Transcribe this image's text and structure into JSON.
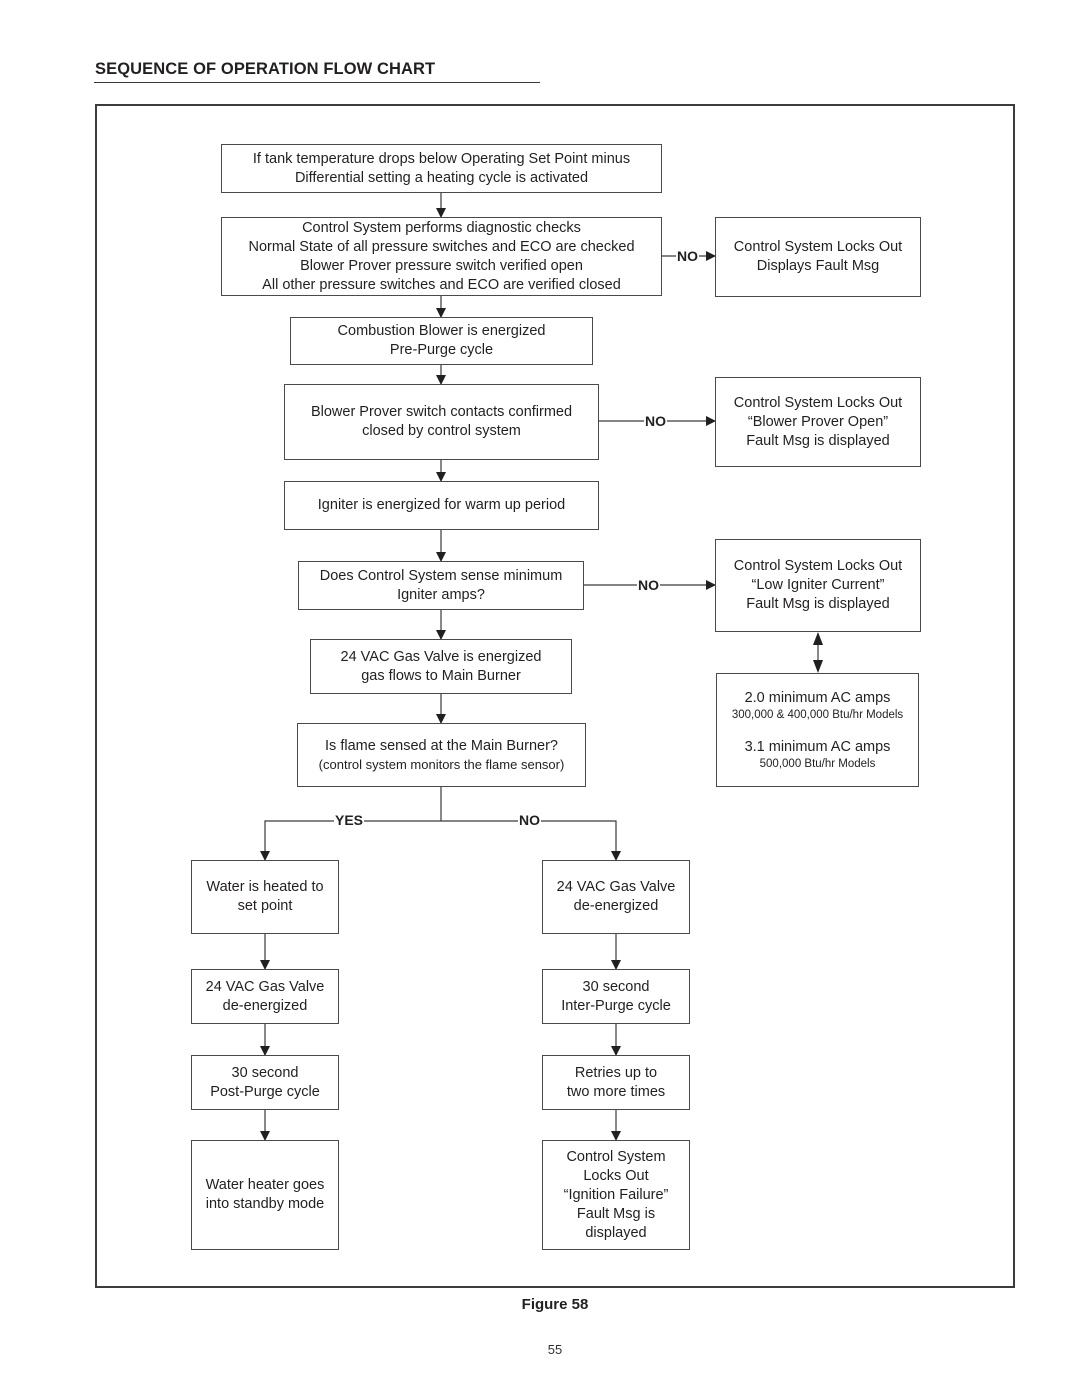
{
  "header": {
    "title": "SEQUENCE OF OPERATION FLOW CHART"
  },
  "flow": {
    "start": [
      "If tank temperature drops below Operating Set Point minus",
      "Differential setting a heating cycle is activated"
    ],
    "diagnostics": [
      "Control System performs diagnostic checks",
      "Normal State of all pressure switches and ECO are checked",
      "Blower Prover pressure switch verified open",
      "All other pressure switches and ECO are verified closed"
    ],
    "lockout_1": [
      "Control System Locks Out",
      "Displays Fault Msg"
    ],
    "blower": [
      "Combustion Blower is energized",
      "Pre-Purge cycle"
    ],
    "prover": [
      "Blower Prover switch contacts confirmed",
      "closed by control system"
    ],
    "lockout_2": [
      "Control System Locks Out",
      "“Blower Prover Open”",
      "Fault Msg is displayed"
    ],
    "igniter": [
      "Igniter is energized for warm up period"
    ],
    "igniter_check": [
      "Does Control System sense minimum",
      "Igniter amps?"
    ],
    "lockout_3": [
      "Control System Locks Out",
      "“Low Igniter Current”",
      "Fault Msg is displayed"
    ],
    "amps_info": {
      "line1": "2.0 minimum AC amps",
      "line1_sub": "300,000 & 400,000 Btu/hr Models",
      "line2": "3.1 minimum AC amps",
      "line2_sub": "500,000 Btu/hr Models"
    },
    "gas_valve_on": [
      "24 VAC Gas Valve is energized",
      "gas flows to Main Burner"
    ],
    "flame_check": [
      "Is flame sensed at the Main Burner?",
      "(control system monitors the flame sensor)"
    ],
    "yes_branch": {
      "step1": [
        "Water is heated to",
        "set point"
      ],
      "step2": [
        "24 VAC Gas Valve",
        "de-energized"
      ],
      "step3": [
        "30 second",
        "Post-Purge cycle"
      ],
      "step4": [
        "Water heater goes",
        "into standby mode"
      ]
    },
    "no_branch": {
      "step1": [
        "24 VAC Gas Valve",
        "de-energized"
      ],
      "step2": [
        "30 second",
        "Inter-Purge cycle"
      ],
      "step3": [
        "Retries up to",
        "two more times"
      ],
      "step4": [
        "Control System",
        "Locks Out",
        "“Ignition Failure”",
        "Fault Msg is",
        "displayed"
      ]
    },
    "labels": {
      "no": "NO",
      "yes": "YES"
    }
  },
  "footer": {
    "caption": "Figure 58",
    "page_number": "55"
  }
}
